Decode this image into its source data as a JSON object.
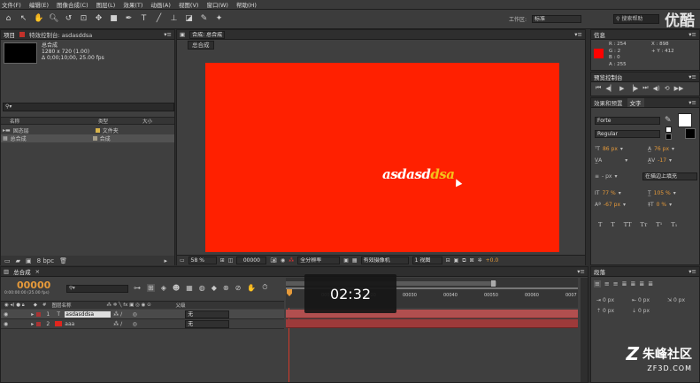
{
  "menu": [
    "文件(F)",
    "编辑(E)",
    "图像合成(C)",
    "图层(L)",
    "效果(T)",
    "动画(A)",
    "视图(V)",
    "窗口(W)",
    "帮助(H)"
  ],
  "toolbar": {
    "workspace_label": "工作区:",
    "workspace_value": "标准",
    "search_placeholder": "搜索帮助"
  },
  "watermark_top": "优酷",
  "project": {
    "tab_label": "项目",
    "effects_tab_label": "特效控制台: asdasddsa",
    "comp_name": "总合成",
    "comp_info_1": "1280 x 720 (1.00)",
    "comp_info_2": "Δ 0;00;10;00, 25.00 fps",
    "search_value": "",
    "col_name": "名称",
    "col_type": "类型",
    "col_size": "大小",
    "items": [
      {
        "name": "固态层",
        "type": "文件夹"
      },
      {
        "name": "总合成",
        "type": "合成"
      }
    ],
    "bpc": "8 bpc"
  },
  "viewer": {
    "tab_label": "合成: 总合成",
    "breadcrumb": "总合成",
    "text_part1": "asdasd",
    "text_part2": "dsa",
    "zoom": "58 %",
    "timecode": "00000",
    "resolution": "全分辨率",
    "camera": "有效摄像机",
    "views": "1 视图",
    "exposure": "+0.0"
  },
  "info": {
    "tab_label": "信息",
    "r": "R : 254",
    "g": "G : 2",
    "b": "B : 0",
    "a": "A : 255",
    "x": "X : 898",
    "y": "+ Y : 412"
  },
  "preview": {
    "tab_label": "预览控制台"
  },
  "text_panel": {
    "effects_tab_label": "效果和预置",
    "text_tab_label": "文字",
    "font": "Forte",
    "style": "Regular",
    "size": "86 px",
    "leading": "76 px",
    "kerning": "",
    "tracking": "-17",
    "stroke_width": "- px",
    "stroke_type": "在描边上填充",
    "vscale": "77 %",
    "hscale": "105 %",
    "baseline": "-67 px",
    "tsume": "0 %",
    "buttons": [
      "T",
      "T",
      "TT",
      "Tт",
      "T¹",
      "T₁"
    ]
  },
  "timeline": {
    "tab_label": "总合成",
    "current_time": "00000",
    "time_sub": "0:00:00:00 (25.00 fps)",
    "search_value": "",
    "col_layer": "图层名称",
    "col_parent": "父级",
    "ticks": [
      "00010",
      "00020",
      "00030",
      "00040",
      "00050",
      "00060",
      "0007"
    ],
    "layers": [
      {
        "num": "1",
        "name": "asdasddsa",
        "type": "T",
        "color": "#c8c8c8",
        "parent": "无"
      },
      {
        "num": "2",
        "name": "aaa",
        "type": "",
        "color": "#e0261e",
        "parent": "无"
      }
    ],
    "overlay_time": "02:32"
  },
  "paragraph": {
    "tab_label": "段落",
    "fields": [
      "0 px",
      "0 px",
      "0 px",
      "0 px",
      "0 px"
    ]
  },
  "watermark_bottom": {
    "logo": "朱峰社区",
    "url": "ZF3D.COM"
  },
  "colors": {
    "accent": "#ff2000",
    "orange": "#e69a3a",
    "layer_bar": "#b14f4f"
  }
}
